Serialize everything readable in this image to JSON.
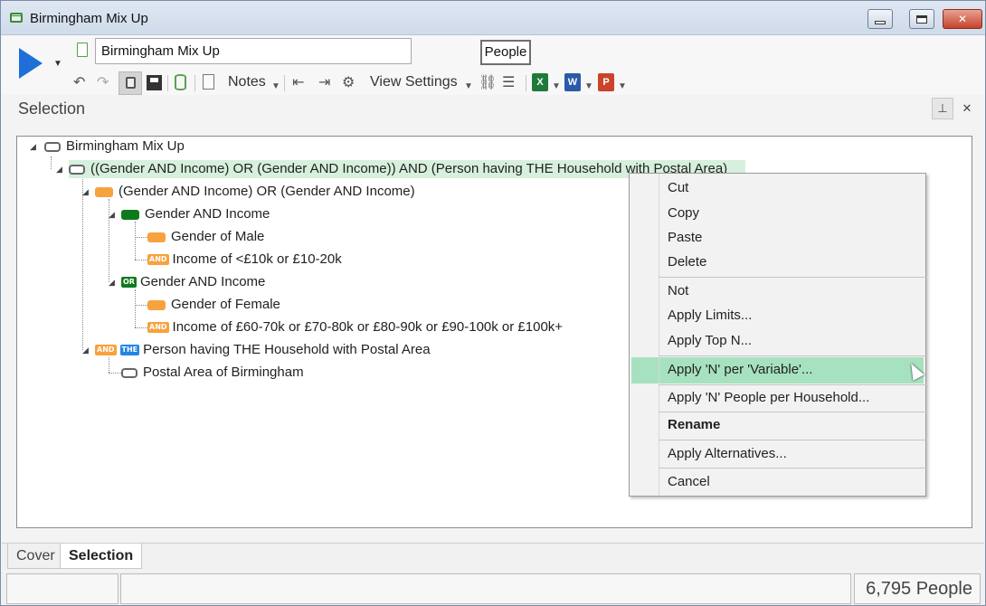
{
  "window": {
    "title": "Birmingham Mix Up"
  },
  "toolbar": {
    "name_value": "Birmingham Mix Up",
    "people_label": "People",
    "notes_label": "Notes",
    "view_settings_label": "View Settings"
  },
  "panel": {
    "title": "Selection"
  },
  "tree": {
    "root": "Birmingham Mix Up",
    "n1": "((Gender AND Income) OR (Gender AND Income)) AND (Person having THE Household with Postal Area)",
    "n2": "(Gender AND Income) OR (Gender AND Income)",
    "n3": "Gender AND Income",
    "n4": "Gender of Male",
    "n5": "Income of <£10k or £10-20k",
    "n6": "Gender AND Income",
    "n7": "Gender of Female",
    "n8": "Income of £60-70k or £70-80k or £80-90k or £90-100k or £100k+",
    "n9": "Person having THE Household with Postal Area",
    "n10": "Postal Area of Birmingham",
    "badge_and": "AND",
    "badge_or": "OR",
    "badge_the": "THE"
  },
  "context_menu": {
    "cut": "Cut",
    "copy": "Copy",
    "paste": "Paste",
    "delete": "Delete",
    "not": "Not",
    "apply_limits": "Apply Limits...",
    "apply_top_n": "Apply Top N...",
    "apply_n_per_variable": "Apply 'N' per 'Variable'...",
    "apply_n_people_per_household": "Apply 'N' People per Household...",
    "rename": "Rename",
    "apply_alternatives": "Apply Alternatives...",
    "cancel": "Cancel"
  },
  "tabs": {
    "cover": "Cover",
    "selection": "Selection"
  },
  "status": {
    "count": "6,795 People"
  },
  "colors": {
    "highlight": "#d7f0dd",
    "menu_hover": "#a7e2c0",
    "orange": "#f7a23f",
    "green": "#0f7a1d",
    "blue": "#2385e0"
  }
}
